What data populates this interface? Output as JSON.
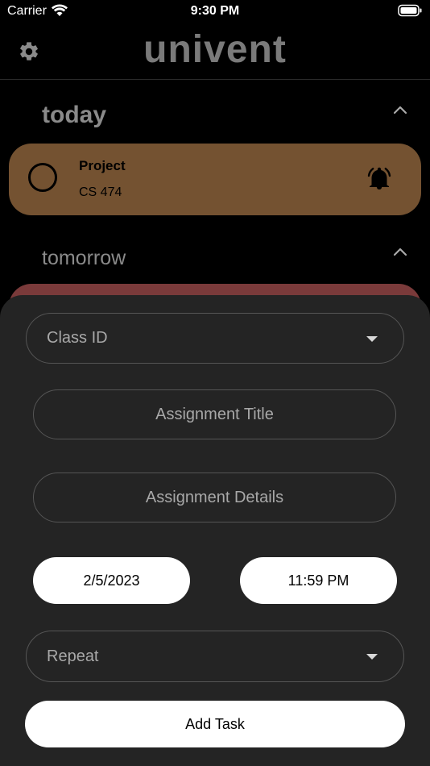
{
  "status_bar": {
    "carrier": "Carrier",
    "time": "9:30 PM"
  },
  "header": {
    "title": "univent"
  },
  "sections": {
    "today": {
      "label": "today",
      "tasks": [
        {
          "title": "Project",
          "course": "CS 474",
          "color": "#745231"
        }
      ]
    },
    "tomorrow": {
      "label": "tomorrow",
      "color": "#7a3a3a"
    }
  },
  "form": {
    "class_id_placeholder": "Class ID",
    "title_placeholder": "Assignment Title",
    "details_placeholder": "Assignment Details",
    "date_value": "2/5/2023",
    "time_value": "11:59 PM",
    "repeat_placeholder": "Repeat",
    "submit_label": "Add Task"
  },
  "icons": {
    "settings": "gear-icon",
    "collapse": "chevron-up-icon",
    "reminder": "bell-icon",
    "dropdown": "caret-down-icon",
    "wifi": "wifi-icon",
    "battery": "battery-icon"
  },
  "colors": {
    "background": "#000000",
    "sheet": "#242424",
    "today_card": "#745231",
    "tomorrow_card": "#7a3a3a",
    "title": "#7a7a7a"
  }
}
